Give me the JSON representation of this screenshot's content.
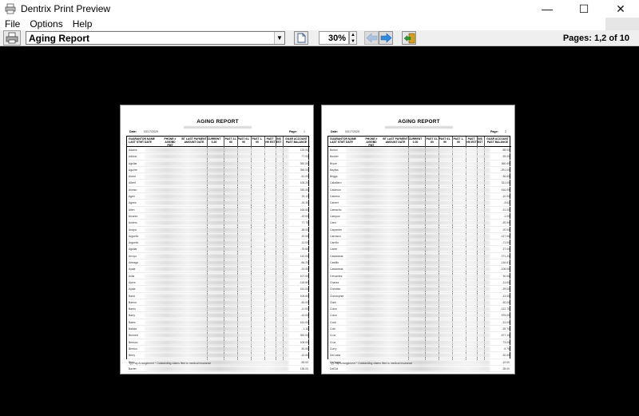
{
  "window": {
    "title": "Dentrix Print Preview",
    "controls": {
      "minimize": "—",
      "maximize": "☐",
      "close": "✕"
    }
  },
  "menu": {
    "items": [
      "File",
      "Options",
      "Help"
    ]
  },
  "toolbar": {
    "report_selected": "Aging Report",
    "zoom": "30%",
    "pages_label": "Pages: 1,2 of 10"
  },
  "pages": [
    {
      "title": "AGING REPORT",
      "date_label": "Date:",
      "date_value": "03/17/2025",
      "page_label": "Page:",
      "page_value": "1",
      "headers": [
        "GUARANTOR NAME LAST STMT DATE",
        "PHONE # AGE/BD PMT",
        "BT LAST PAYMENT AMOUNT DATE",
        "CURRENT 0-30",
        "PAST 31-60",
        "PAST 61-90",
        "PAST 1-90",
        "PAST >90 EST",
        "INS EST",
        "GUAR ACCOUNT PAST BALANCE"
      ],
      "rows": [
        {
          "name": "Adams",
          "bal": "125.00"
        },
        {
          "name": "Adkins",
          "bal": "77.00"
        },
        {
          "name": "Aguilar",
          "bal": "360.00"
        },
        {
          "name": "Aguirre",
          "bal": "356.00"
        },
        {
          "name": "Aland",
          "bal": "-51.00"
        },
        {
          "name": "Albert",
          "bal": "106.20"
        },
        {
          "name": "Alonso",
          "bal": "330.00"
        },
        {
          "name": "Agen",
          "bal": "19.12"
        },
        {
          "name": "Agnes",
          "bal": "-16.30"
        },
        {
          "name": "Allen",
          "bal": "166.60"
        },
        {
          "name": "Alvarez",
          "bal": "-19.00"
        },
        {
          "name": "Anders",
          "bal": "77.75"
        },
        {
          "name": "Anaya",
          "bal": "-38.00"
        },
        {
          "name": "Arguello",
          "bal": "20.00"
        },
        {
          "name": "Arguello",
          "bal": "-11.00"
        },
        {
          "name": "Aguilar",
          "bal": "-75.60"
        },
        {
          "name": "Arroyo",
          "bal": "110.00"
        },
        {
          "name": "Arteaga",
          "bal": "-66.20"
        },
        {
          "name": "Ayala",
          "bal": "20.00"
        },
        {
          "name": "Avila",
          "bal": "107.00"
        },
        {
          "name": "Ayers",
          "bal": "-118.80"
        },
        {
          "name": "Ayala",
          "bal": "151.00"
        },
        {
          "name": "Baird",
          "bal": "105.60"
        },
        {
          "name": "Barron",
          "bal": "-50.00"
        },
        {
          "name": "Barrio",
          "bal": "-11.00"
        },
        {
          "name": "Barry",
          "bal": "-10.00"
        },
        {
          "name": "Bates",
          "bal": "161.00"
        },
        {
          "name": "Batiste",
          "bal": "-1.10"
        },
        {
          "name": "Bennett",
          "bal": "392.00"
        },
        {
          "name": "Benson",
          "bal": "106.00"
        },
        {
          "name": "Benton",
          "bal": "90.00"
        },
        {
          "name": "Berry",
          "bal": "-10.00"
        },
        {
          "name": "Bird",
          "bal": "-55.00"
        },
        {
          "name": "Baxter",
          "bal": "136.00"
        }
      ],
      "footer": "Q) Pay Arrangement   * Outstanding claims filed to medical insurance"
    },
    {
      "title": "AGING REPORT",
      "date_label": "Date:",
      "date_value": "03/17/2025",
      "page_label": "Page:",
      "page_value": "2",
      "headers": [
        "GUARANTOR NAME LAST STMT DATE",
        "PHONE # AGE/BD PMT",
        "BT LAST PAYMENT AMOUNT DATE",
        "CURRENT 0-30",
        "PAST 31-60",
        "PAST 61-90",
        "PAST 1-90",
        "PAST >90 EST",
        "INS EST",
        "GUAR ACCOUNT PAST BALANCE"
      ],
      "rows": [
        {
          "name": "Bolton",
          "bal": "88.00"
        },
        {
          "name": "Booker",
          "bal": "-39.00"
        },
        {
          "name": "Bryce",
          "bal": "360.00"
        },
        {
          "name": "Bayliss",
          "bal": "-251.00"
        },
        {
          "name": "Briggs",
          "bal": "-36.60"
        },
        {
          "name": "Caballero",
          "bal": "321.00"
        },
        {
          "name": "Calderon",
          "bal": "516.09"
        },
        {
          "name": "Cabrera",
          "bal": "-10.00"
        },
        {
          "name": "Calvert",
          "bal": "-3.62"
        },
        {
          "name": "Camacho",
          "bal": "-31.00"
        },
        {
          "name": "Campos",
          "bal": "-1.00"
        },
        {
          "name": "Cano",
          "bal": "-20.00"
        },
        {
          "name": "Carpenter",
          "bal": "20.00"
        },
        {
          "name": "Carrasco",
          "bal": "-117.00"
        },
        {
          "name": "Carrillo",
          "bal": "-71.00"
        },
        {
          "name": "Carter",
          "bal": "27.00"
        },
        {
          "name": "Castaneda",
          "bal": "271.20"
        },
        {
          "name": "Castillo",
          "bal": "-116.61"
        },
        {
          "name": "Castaneda",
          "bal": "-106.00"
        },
        {
          "name": "Cervantes",
          "bal": "30.00"
        },
        {
          "name": "Chavez",
          "bal": "-11.60"
        },
        {
          "name": "Christian",
          "bal": "-29.00"
        },
        {
          "name": "Christopher",
          "bal": "-13.00"
        },
        {
          "name": "Clark",
          "bal": "-30.00"
        },
        {
          "name": "Colon",
          "bal": "-122.70"
        },
        {
          "name": "Colon",
          "bal": "575.00"
        },
        {
          "name": "Cook",
          "bal": "-31.00"
        },
        {
          "name": "Cole",
          "bal": "-39.70"
        },
        {
          "name": "Cruz",
          "bal": "-577.10"
        },
        {
          "name": "Cruz",
          "bal": "73.00"
        },
        {
          "name": "Curry",
          "bal": "-9.70"
        },
        {
          "name": "DeCosta",
          "bal": "20.00"
        },
        {
          "name": "DeCosta",
          "bal": "-10.00"
        },
        {
          "name": "DelCid",
          "bal": "-35.00"
        }
      ],
      "footer": "Q) Pay Arrangement   * Outstanding claims filed to medical insurance"
    }
  ]
}
